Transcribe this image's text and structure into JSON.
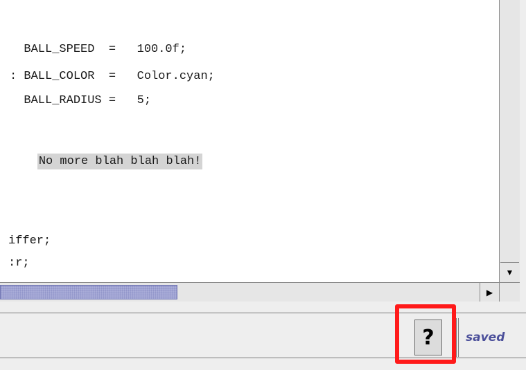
{
  "editor": {
    "lines": [
      "  BALL_SPEED  =   100.0f;",
      ": BALL_COLOR  =   Color.cyan;",
      "  BALL_RADIUS =   5;",
      "No more blah blah blah!",
      "iffer;",
      ":r;"
    ]
  },
  "scrollbars": {
    "vertical_down_arrow": "▼",
    "horizontal_right_arrow": "▶",
    "thumb_color": "#a9acd8"
  },
  "status_bar": {
    "help_button_label": "?",
    "status_text": "saved",
    "status_color": "#4b4f9a",
    "highlight_color": "#ff1a1a"
  }
}
